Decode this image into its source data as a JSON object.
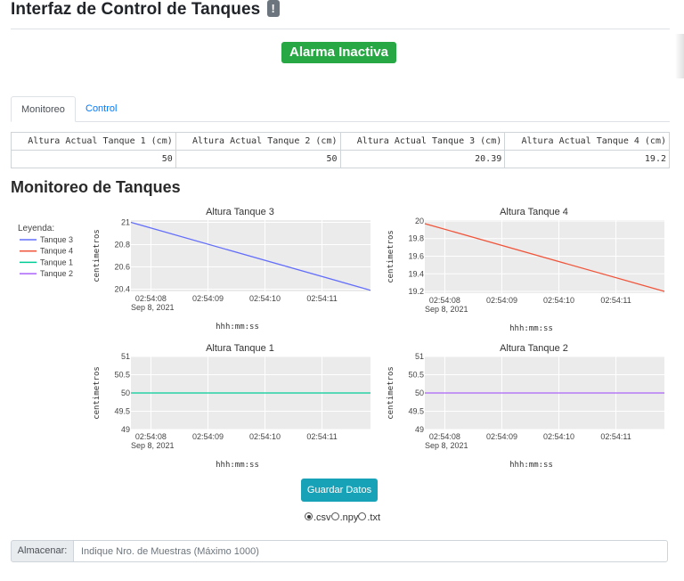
{
  "header": {
    "title": "Interfaz de Control de Tanques",
    "info_badge": "!"
  },
  "alarm": {
    "label": "Alarma Inactiva",
    "color": "#28a745"
  },
  "tabs": [
    {
      "label": "Monitoreo",
      "active": true
    },
    {
      "label": "Control",
      "active": false
    }
  ],
  "readout_table": {
    "headers": [
      "Altura Actual Tanque 1 (cm)",
      "Altura Actual Tanque 2 (cm)",
      "Altura Actual Tanque 3 (cm)",
      "Altura Actual Tanque 4 (cm)"
    ],
    "values": [
      "50",
      "50",
      "20.39",
      "19.2"
    ]
  },
  "section_title": "Monitoreo de Tanques",
  "legend": {
    "title": "Leyenda:",
    "items": [
      {
        "name": "Tanque 3",
        "color": "#636efa"
      },
      {
        "name": "Tanque 4",
        "color": "#ef553b"
      },
      {
        "name": "Tanque 1",
        "color": "#00cc96"
      },
      {
        "name": "Tanque 2",
        "color": "#ab63fa"
      }
    ]
  },
  "chart_data": [
    {
      "type": "line",
      "title": "Altura Tanque 3",
      "xlabel": "hhh:mm:ss",
      "ylabel": "centimetros",
      "x_ticks": [
        "02:54:08",
        "02:54:09",
        "02:54:10",
        "02:54:11"
      ],
      "x_date_label": "Sep 8, 2021",
      "x_range": [
        0,
        4.2
      ],
      "ylim": [
        20.38,
        21.02
      ],
      "y_ticks": [
        "21",
        "20.8",
        "20.6",
        "20.4"
      ],
      "y_tick_values": [
        21,
        20.8,
        20.6,
        20.4
      ],
      "series": [
        {
          "name": "Tanque 3",
          "color": "#636efa",
          "x": [
            0,
            4.2
          ],
          "y": [
            21.0,
            20.39
          ]
        }
      ]
    },
    {
      "type": "line",
      "title": "Altura Tanque 4",
      "xlabel": "hhh:mm:ss",
      "ylabel": "centimetros",
      "x_ticks": [
        "02:54:08",
        "02:54:09",
        "02:54:10",
        "02:54:11"
      ],
      "x_date_label": "Sep 8, 2021",
      "x_range": [
        0,
        4.2
      ],
      "ylim": [
        19.18,
        20.01
      ],
      "y_ticks": [
        "20",
        "19.8",
        "19.6",
        "19.4",
        "19.2"
      ],
      "y_tick_values": [
        20,
        19.8,
        19.6,
        19.4,
        19.2
      ],
      "series": [
        {
          "name": "Tanque 4",
          "color": "#ef553b",
          "x": [
            0,
            4.2
          ],
          "y": [
            19.97,
            19.2
          ]
        }
      ]
    },
    {
      "type": "line",
      "title": "Altura Tanque 1",
      "xlabel": "hhh:mm:ss",
      "ylabel": "centimetros",
      "x_ticks": [
        "02:54:08",
        "02:54:09",
        "02:54:10",
        "02:54:11"
      ],
      "x_date_label": "Sep 8, 2021",
      "x_range": [
        0,
        4.2
      ],
      "ylim": [
        49,
        51
      ],
      "y_ticks": [
        "51",
        "50.5",
        "50",
        "49.5",
        "49"
      ],
      "y_tick_values": [
        51,
        50.5,
        50,
        49.5,
        49
      ],
      "series": [
        {
          "name": "Tanque 1",
          "color": "#00cc96",
          "x": [
            0,
            4.2
          ],
          "y": [
            50,
            50
          ]
        }
      ]
    },
    {
      "type": "line",
      "title": "Altura Tanque 2",
      "xlabel": "hhh:mm:ss",
      "ylabel": "centimetros",
      "x_ticks": [
        "02:54:08",
        "02:54:09",
        "02:54:10",
        "02:54:11"
      ],
      "x_date_label": "Sep 8, 2021",
      "x_range": [
        0,
        4.2
      ],
      "ylim": [
        49,
        51
      ],
      "y_ticks": [
        "51",
        "50.5",
        "50",
        "49.5",
        "49"
      ],
      "y_tick_values": [
        51,
        50.5,
        50,
        49.5,
        49
      ],
      "series": [
        {
          "name": "Tanque 2",
          "color": "#ab63fa",
          "x": [
            0,
            4.2
          ],
          "y": [
            50,
            50
          ]
        }
      ]
    }
  ],
  "save_button": {
    "label": "Guardar Datos",
    "color": "#17a2b8"
  },
  "formats": {
    "options": [
      ".csv",
      ".npy",
      ".txt"
    ],
    "selected": ".csv"
  },
  "store": {
    "label": "Almacenar:",
    "placeholder": "Indique Nro. de Muestras (Máximo 1000)"
  }
}
